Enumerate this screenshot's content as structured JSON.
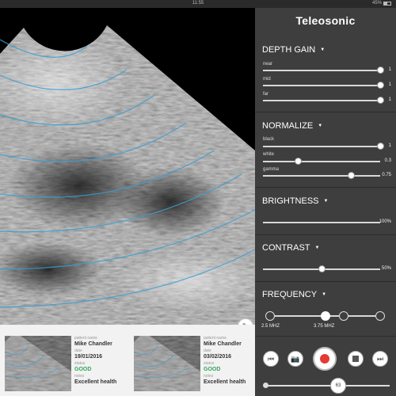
{
  "status_bar": {
    "time": "11:55",
    "battery": "45%",
    "battery_level": 0.45
  },
  "brand": "Teleosonic",
  "depth_gain": {
    "title": "DEPTH GAIN",
    "caret_icon": "caret-down-icon",
    "sliders": [
      {
        "label": "near",
        "value": "1",
        "fraction": 1.0
      },
      {
        "label": "mid",
        "value": "1",
        "fraction": 1.0
      },
      {
        "label": "far",
        "value": "1",
        "fraction": 1.0
      }
    ]
  },
  "normalize": {
    "title": "NORMALIZE",
    "sliders": [
      {
        "label": "black",
        "value": "1",
        "fraction": 1.0
      },
      {
        "label": "white",
        "value": "0.3",
        "fraction": 0.3
      },
      {
        "label": "gamma",
        "value": "0.75",
        "fraction": 0.75
      }
    ]
  },
  "brightness": {
    "title": "BRIGHTNESS",
    "value": "100%",
    "fraction": 1.0
  },
  "contrast": {
    "title": "CONTRAST",
    "value": "50%",
    "fraction": 0.5
  },
  "frequency": {
    "title": "FREQUENCY",
    "stops": 4,
    "selected_index": 1,
    "labels": [
      "2.5 MHZ",
      "3.75 MHZ"
    ]
  },
  "controls": {
    "skip_back_icon": "skip-back-icon",
    "camera_icon": "camera-icon",
    "record_icon": "record-icon",
    "stop_icon": "stop-icon",
    "skip_forward_icon": "skip-forward-icon",
    "record_color": "#e53935"
  },
  "timeline": {
    "value": "63"
  },
  "history": [
    {
      "name_label": "patient name",
      "name": "Mike Chandler",
      "date_label": "date",
      "date": "19/01/2016",
      "status_label": "status",
      "status": "GOOD",
      "notes_label": "notes",
      "notes": "Excellent health"
    },
    {
      "name_label": "patient name",
      "name": "Mike Chandler",
      "date_label": "date",
      "date": "03/02/2016",
      "status_label": "status",
      "status": "GOOD",
      "notes_label": "notes",
      "notes": "Excellent health"
    }
  ],
  "colors": {
    "panel": "#3e3e3e",
    "status_good": "#2ea65a",
    "depth_ring": "#3a9fd6"
  },
  "edit_icon": "pencil-icon"
}
